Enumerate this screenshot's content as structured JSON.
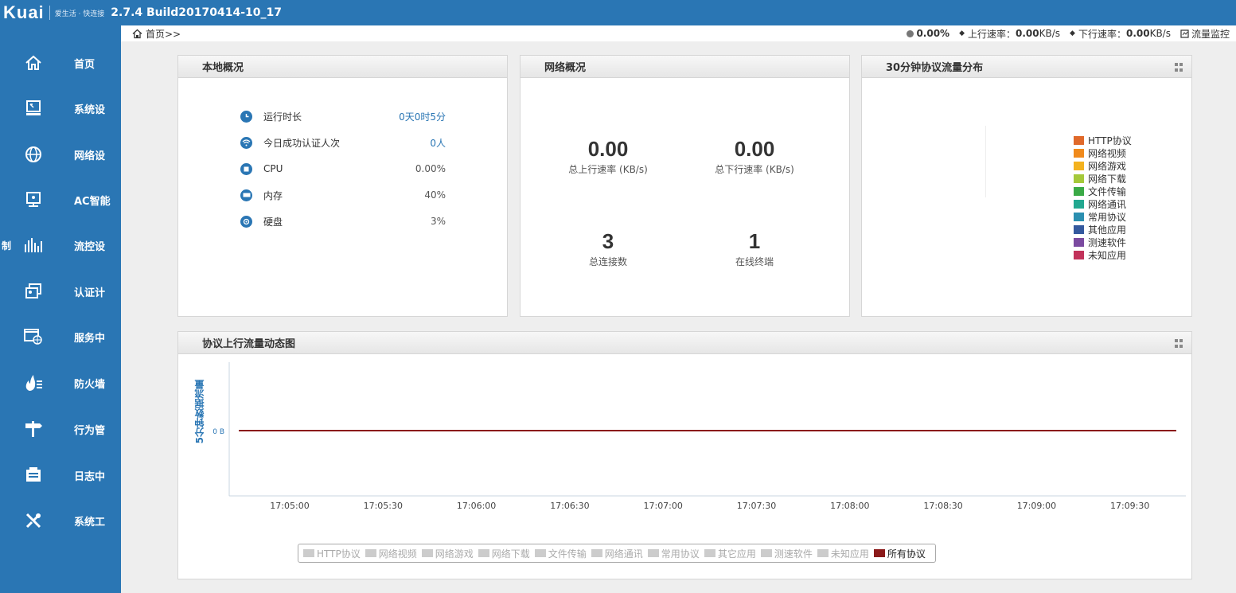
{
  "app": {
    "logo": "Kuai",
    "slogan": "爱生活 · 快连接",
    "version": "2.7.4 Build20170414-10_17"
  },
  "sidebar": {
    "items": [
      {
        "label": "首页",
        "icon": "home-icon"
      },
      {
        "label": "系统设",
        "icon": "monitor-icon"
      },
      {
        "label": "网络设",
        "icon": "globe-icon"
      },
      {
        "label": "AC智能",
        "icon": "screen-icon"
      },
      {
        "label": "流控设",
        "icon": "bars-icon",
        "prefix": "制"
      },
      {
        "label": "认证计",
        "icon": "auth-icon"
      },
      {
        "label": "服务中",
        "icon": "window-globe-icon"
      },
      {
        "label": "防火墙",
        "icon": "fire-icon"
      },
      {
        "label": "行为管",
        "icon": "signpost-icon"
      },
      {
        "label": "日志中",
        "icon": "log-icon"
      },
      {
        "label": "系统工",
        "icon": "tools-icon"
      }
    ]
  },
  "breadcrumb": {
    "text": "首页>>"
  },
  "status": {
    "cpu": "0.00%",
    "up_label": "上行速率：",
    "up_value": "0.00",
    "up_unit": "KB/s",
    "down_label": "下行速率：",
    "down_value": "0.00",
    "down_unit": "KB/s",
    "monitor": "流量监控"
  },
  "local": {
    "title": "本地概况",
    "rows": [
      {
        "label": "运行时长",
        "value": "0天0时5分",
        "icon": "clock-icon"
      },
      {
        "label": "今日成功认证人次",
        "value": "0人",
        "icon": "wifi-icon"
      },
      {
        "label": "CPU",
        "value": "0.00%",
        "icon": "cpu-icon"
      },
      {
        "label": "内存",
        "value": "40%",
        "icon": "memory-icon"
      },
      {
        "label": "硬盘",
        "value": "3%",
        "icon": "disk-icon"
      }
    ]
  },
  "network": {
    "title": "网络概况",
    "up_value": "0.00",
    "up_caption": "总上行速率 (KB/s)",
    "down_value": "0.00",
    "down_caption": "总下行速率 (KB/s)",
    "conn_value": "3",
    "conn_caption": "总连接数",
    "online_value": "1",
    "online_caption": "在线终端"
  },
  "dist": {
    "title": "30分钟协议流量分布",
    "legend": [
      {
        "name": "HTTP协议",
        "color": "#e0692a"
      },
      {
        "name": "网络视频",
        "color": "#f08a1c"
      },
      {
        "name": "网络游戏",
        "color": "#f3b21f"
      },
      {
        "name": "网络下载",
        "color": "#a5c93a"
      },
      {
        "name": "文件传输",
        "color": "#3aaa46"
      },
      {
        "name": "网络通讯",
        "color": "#22a890"
      },
      {
        "name": "常用协议",
        "color": "#2b8fb0"
      },
      {
        "name": "其他应用",
        "color": "#34599e"
      },
      {
        "name": "测速软件",
        "color": "#7b4aa0"
      },
      {
        "name": "未知应用",
        "color": "#c2325a"
      }
    ]
  },
  "dynamic": {
    "title": "协议上行流量动态图",
    "ylabel": "5分钟数据流量"
  },
  "chart_data": {
    "type": "line",
    "title": "协议上行流量动态图",
    "ylabel": "5分钟数据流量",
    "y_ticks": [
      "0 B"
    ],
    "x": [
      "17:05:00",
      "17:05:30",
      "17:06:00",
      "17:06:30",
      "17:07:00",
      "17:07:30",
      "17:08:00",
      "17:08:30",
      "17:09:00",
      "17:09:30"
    ],
    "series": [
      {
        "name": "所有协议",
        "color": "#8b1a1a",
        "values": [
          0,
          0,
          0,
          0,
          0,
          0,
          0,
          0,
          0,
          0
        ]
      }
    ],
    "legend": [
      {
        "name": "HTTP协议",
        "active": false
      },
      {
        "name": "网络视频",
        "active": false
      },
      {
        "name": "网络游戏",
        "active": false
      },
      {
        "name": "网络下载",
        "active": false
      },
      {
        "name": "文件传输",
        "active": false
      },
      {
        "name": "网络通讯",
        "active": false
      },
      {
        "name": "常用协议",
        "active": false
      },
      {
        "name": "其它应用",
        "active": false
      },
      {
        "name": "测速软件",
        "active": false
      },
      {
        "name": "未知应用",
        "active": false
      },
      {
        "name": "所有协议",
        "active": true
      }
    ]
  }
}
